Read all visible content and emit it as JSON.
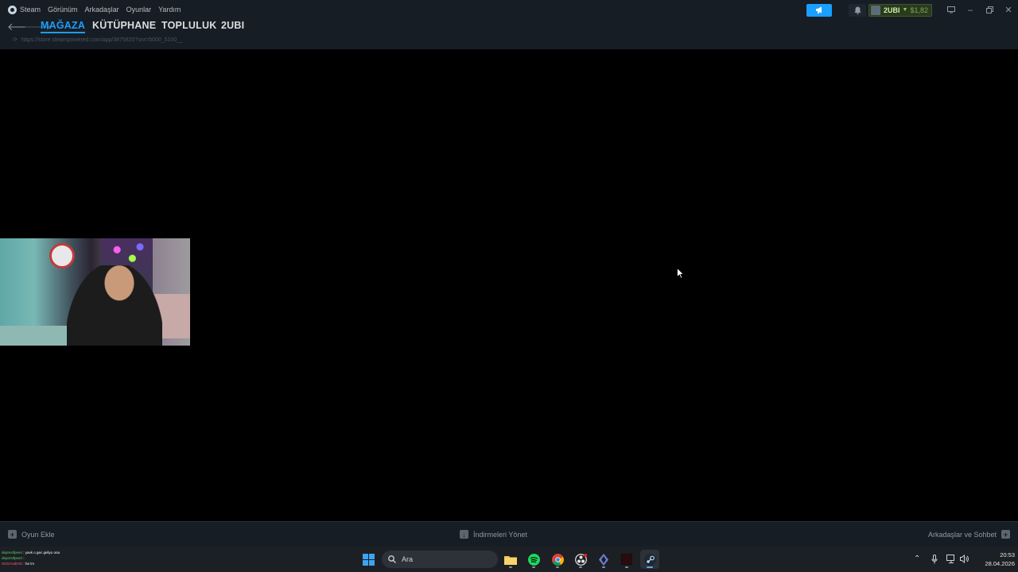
{
  "menubar": {
    "items": [
      "Steam",
      "Görünüm",
      "Arkadaşlar",
      "Oyunlar",
      "Yardım"
    ],
    "profile": {
      "name": "2UBI",
      "balance": "$1,82"
    }
  },
  "nav": {
    "tabs": [
      "MAĞAZA",
      "KÜTÜPHANE",
      "TOPLULUK",
      "2UBI"
    ],
    "active_tab": "MAĞAZA",
    "url": "https://store.steampowered.com/app/3875820?snr=5000_5100__"
  },
  "bottombar": {
    "add_game": "Oyun Ekle",
    "downloads": "İndirmeleri Yönet",
    "friends": "Arkadaşlar ve Sohbet"
  },
  "chat": [
    {
      "user": "depresifpeeri",
      "message": ": yavk o gec geliyo ona"
    },
    {
      "user": "depresifpeeri",
      "message": ":"
    },
    {
      "user": "SOGArabHG",
      "message": ": he lm"
    }
  ],
  "taskbar": {
    "search_label": "Ara",
    "time": "20:53",
    "date": "28.04.2026"
  },
  "colors": {
    "steam_bg": "#171d25",
    "accent": "#1a9fff",
    "profile_green": "#d2efa9"
  }
}
